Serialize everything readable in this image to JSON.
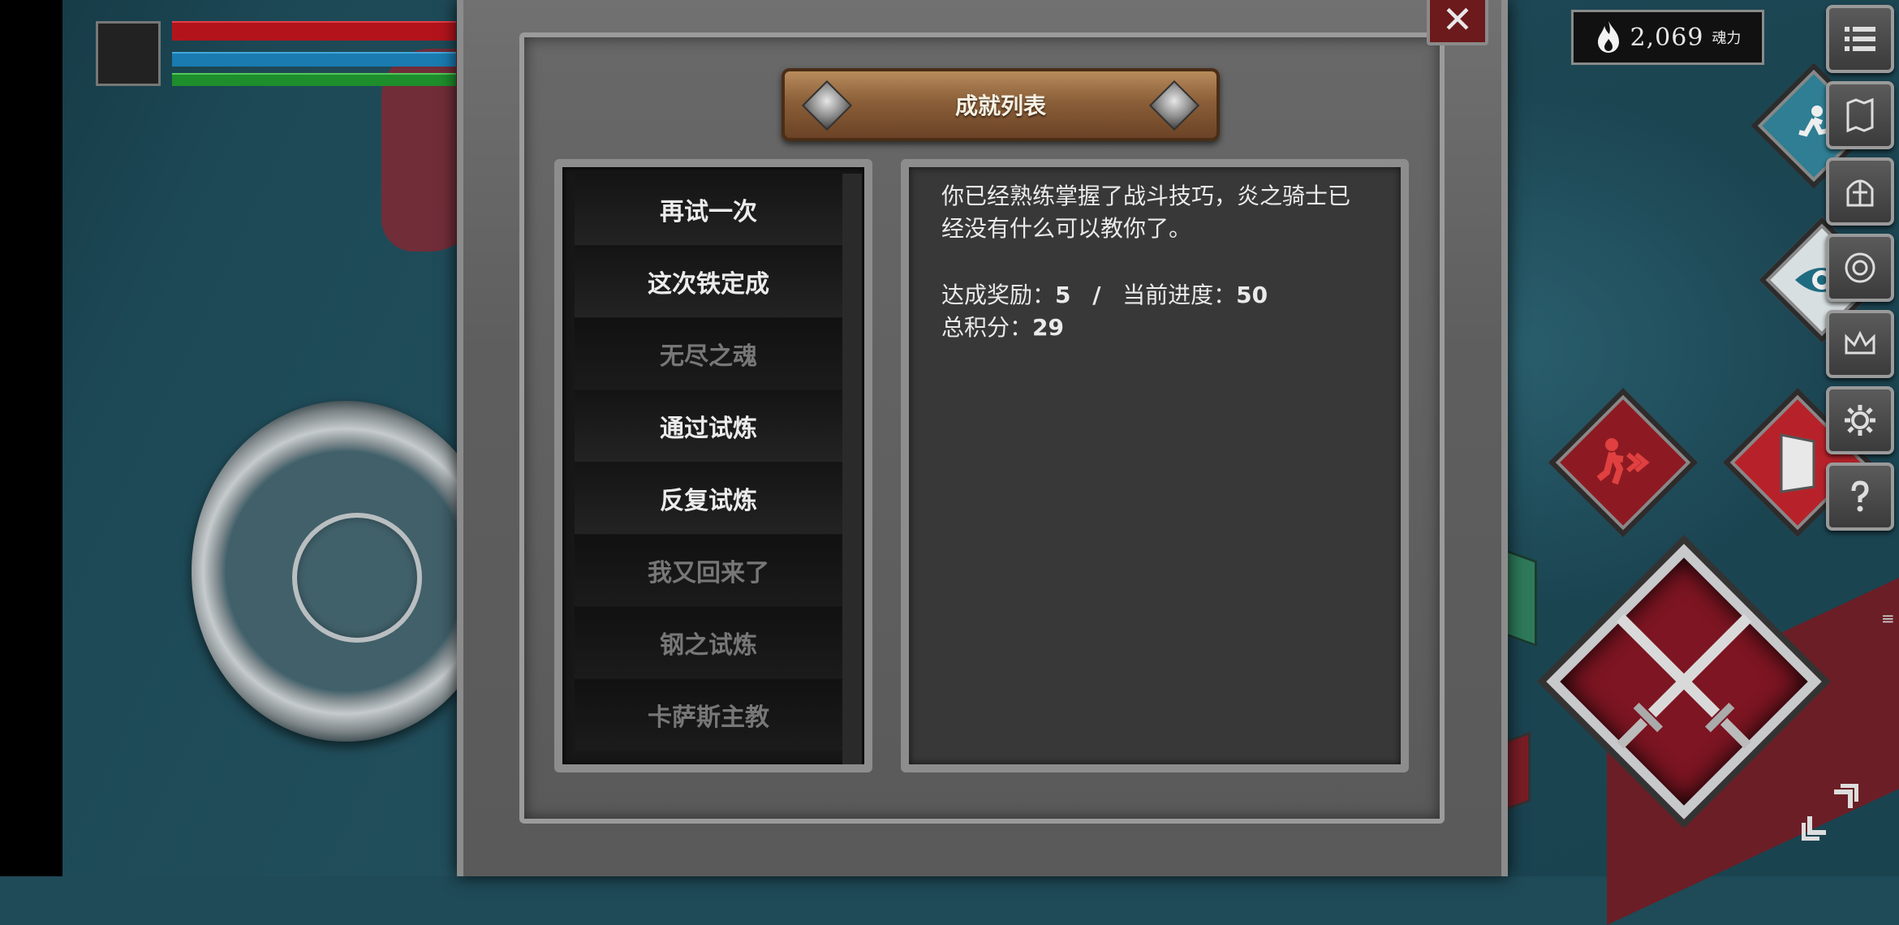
{
  "hud": {
    "soul_value": "2,069",
    "soul_unit": "魂力",
    "colors": {
      "hp": "#b3141c",
      "mp": "#1a7bb0",
      "stamina": "#1e8d2c"
    }
  },
  "dialog": {
    "title": "成就列表",
    "close_icon": "close-icon",
    "achievements": [
      {
        "label": "再试一次",
        "unlocked": true
      },
      {
        "label": "这次铁定成",
        "unlocked": true
      },
      {
        "label": "无尽之魂",
        "unlocked": false
      },
      {
        "label": "通过试炼",
        "unlocked": true
      },
      {
        "label": "反复试炼",
        "unlocked": true
      },
      {
        "label": "我又回来了",
        "unlocked": false
      },
      {
        "label": "钢之试炼",
        "unlocked": false
      },
      {
        "label": "卡萨斯主教",
        "unlocked": false
      }
    ],
    "detail": {
      "description": "你已经熟练掌握了战斗技巧，炎之骑士已经没有什么可以教你了。",
      "reward_label": "达成奖励：",
      "reward_value": "5",
      "separator": "/",
      "progress_label": "当前进度：",
      "progress_value": "50",
      "total_label": "总积分：",
      "total_value": "29"
    }
  },
  "menu": {
    "icons": [
      "menu-list-icon",
      "map-icon",
      "helmet-icon",
      "skill-tree-icon",
      "crown-icon",
      "gear-icon",
      "help-icon"
    ]
  }
}
